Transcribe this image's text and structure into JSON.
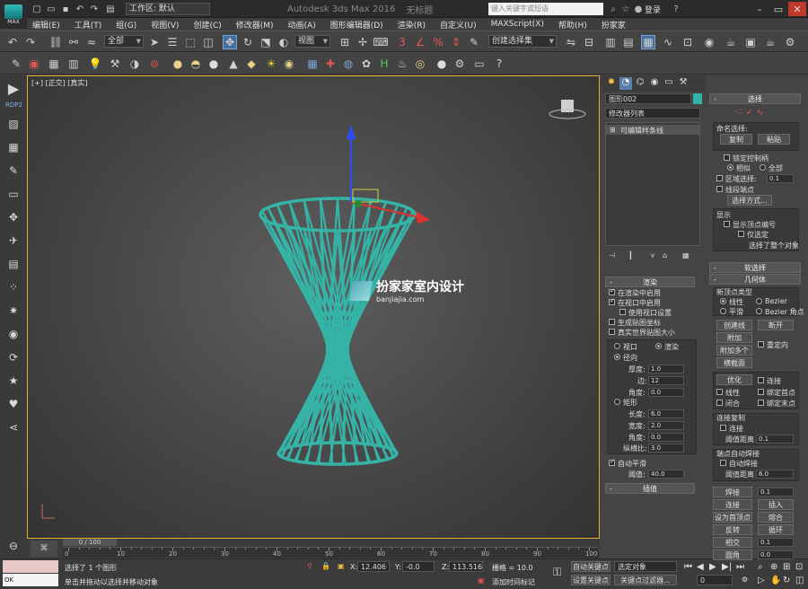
{
  "title": {
    "logo_label": "MAX",
    "workspace": "工作区: 默认",
    "app_title": "Autodesk 3ds Max 2016",
    "file_name": "无标题",
    "search_placeholder": "键入关键字或短语",
    "login": "登录"
  },
  "menu": [
    "编辑(E)",
    "工具(T)",
    "组(G)",
    "视图(V)",
    "创建(C)",
    "修改器(M)",
    "动画(A)",
    "图形编辑器(D)",
    "渲染(R)",
    "自定义(U)",
    "MAXScript(X)",
    "帮助(H)",
    "扮家家"
  ],
  "toolbar": {
    "selection_filter": "全部",
    "ref_coord": "视图",
    "named_selection": "创建选择集"
  },
  "left_strip": {
    "label": "RDP2"
  },
  "viewport": {
    "label": "[+] [正交] [真实]",
    "watermark_title": "扮家家室内设计",
    "watermark_url": "banjiajia.com"
  },
  "timeslider": {
    "frame": "0 / 100",
    "ticks": [
      "0",
      "10",
      "20",
      "30",
      "40",
      "50",
      "60",
      "70",
      "80",
      "90",
      "100"
    ]
  },
  "status": {
    "prompt1": "选择了 1 个图形",
    "prompt2": "单击并拖动以选择并移动对象",
    "x_label": "X:",
    "x_value": "12.406",
    "y_label": "Y:",
    "y_value": "-0.0",
    "z_label": "Z:",
    "z_value": "113.516",
    "grid": "栅格 = 10.0",
    "add_time_tag": "添加时间标记",
    "auto_key": "自动关键点",
    "set_key": "设置关键点",
    "selected_object": "选定对象",
    "key_filters": "关键点过滤器...",
    "frame_value": "0",
    "maxscript_text": "OK"
  },
  "command_panel": {
    "object_name": "图形002",
    "modifier_list": "修改器列表",
    "stack_item": "可编辑样条线",
    "render_rollout": "渲染",
    "enable_in_renderer": "在渲染中启用",
    "enable_in_viewport": "在视口中启用",
    "use_viewport_settings": "使用视口设置",
    "gen_mapping": "生成贴图坐标",
    "real_world_map": "真实世界贴图大小",
    "viewport_radio": "视口",
    "render_radio": "渲染",
    "radial": "径向",
    "thickness_label": "厚度:",
    "thickness": "1.0",
    "sides_label": "边:",
    "sides": "12",
    "angle_label": "角度:",
    "angle": "0.0",
    "rectangular": "矩形",
    "length_label": "长度:",
    "length": "6.0",
    "width_label": "宽度:",
    "width": "2.0",
    "angle2_label": "角度:",
    "angle2": "0.0",
    "aspect_label": "纵横比:",
    "aspect": "3.0",
    "auto_smooth": "自动平滑",
    "threshold_label": "阈值:",
    "threshold": "40.0",
    "interp_rollout": "插值"
  },
  "right_panel": {
    "selection_rollout": "选择",
    "named_sel": "命名选择:",
    "copy": "复制",
    "paste": "粘贴",
    "lock_handles": "锁定控制柄",
    "alike": "相似",
    "all": "全部",
    "area_select": "区域选择:",
    "area_value": "0.1",
    "segment_end": "线段端点",
    "select_by": "选择方式...",
    "display": "显示",
    "show_vertex_numbers": "显示顶点编号",
    "selected_only": "仅选定",
    "sel_status": "选择了整个对象",
    "soft_sel": "软选择",
    "geometry": "几何体",
    "new_vertex_type": "新顶点类型",
    "linear": "线性",
    "bezier": "Bezier",
    "smooth": "平滑",
    "bezier_corner": "Bezier 角点",
    "create_line": "创建线",
    "break": "断开",
    "attach": "附加",
    "reorient": "重定向",
    "attach_mult": "附加多个",
    "cross_section": "横截面",
    "refine": "优化",
    "connect": "连接",
    "linear2": "线性",
    "bind_first": "绑定首点",
    "closed": "闭合",
    "bind_last": "绑定末点",
    "connect_copy": "连接复制",
    "connect_chk": "连接",
    "thresh_dist": "阈值距离",
    "thresh_val": "0.1",
    "end_auto_weld": "端点自动焊接",
    "auto_weld": "自动焊接",
    "weld_thresh": "阈值距离",
    "weld_val": "6.0",
    "weld": "焊接",
    "weld_v": "0.1",
    "connect_btn": "连接",
    "insert": "插入",
    "set_first": "设为首顶点",
    "fuse": "熔合",
    "reverse": "反转",
    "cycle": "循环",
    "cross": "相交",
    "cross_v": "0.1",
    "fillet": "圆角",
    "fillet_v": "0.0"
  }
}
